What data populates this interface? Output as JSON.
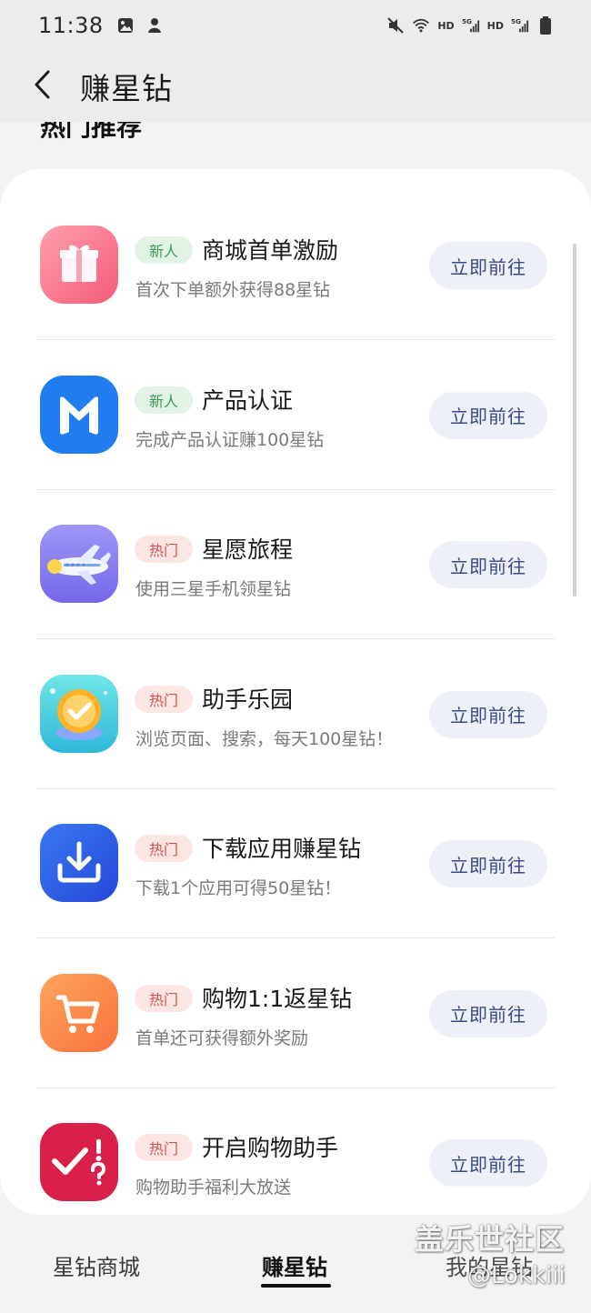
{
  "status_bar": {
    "time": "11:38",
    "icons_left": [
      "gallery-icon",
      "notification-icon"
    ],
    "icons_right": [
      "mute-icon",
      "wifi-icon",
      "hd-label",
      "signal-5g-icon",
      "hd-label",
      "signal-5g-icon",
      "battery-icon"
    ],
    "hd_label": "HD"
  },
  "header": {
    "title": "赚星钻",
    "back_icon": "back-arrow-icon"
  },
  "section": {
    "title": "热门推荐"
  },
  "tasks": [
    {
      "badge": "新人",
      "badge_type": "new",
      "title": "商城首单激励",
      "desc": "首次下单额外获得88星钻",
      "button": "立即前往",
      "icon": "gift-icon",
      "icon_color": "#f8758c"
    },
    {
      "badge": "新人",
      "badge_type": "new",
      "title": "产品认证",
      "desc": "完成产品认证赚100星钻",
      "button": "立即前往",
      "icon": "m-logo-icon",
      "icon_color": "#1f7df0"
    },
    {
      "badge": "热门",
      "badge_type": "hot",
      "title": "星愿旅程",
      "desc": "使用三星手机领星钻",
      "button": "立即前往",
      "icon": "airplane-icon",
      "icon_color": "#8f86f0"
    },
    {
      "badge": "热门",
      "badge_type": "hot",
      "title": "助手乐园",
      "desc": "浏览页面、搜索，每天100星钻！",
      "button": "立即前往",
      "icon": "checkmark-coin-icon",
      "icon_color": "#3fcfd8"
    },
    {
      "badge": "热门",
      "badge_type": "hot",
      "title": "下载应用赚星钻",
      "desc": "下载1个应用可得50星钻！",
      "button": "立即前往",
      "icon": "download-icon",
      "icon_color": "#2f5fe8"
    },
    {
      "badge": "热门",
      "badge_type": "hot",
      "title": "购物1:1返星钻",
      "desc": "首单还可获得额外奖励",
      "button": "立即前往",
      "icon": "shopping-cart-icon",
      "icon_color": "#fb8a4a"
    },
    {
      "badge": "热门",
      "badge_type": "hot",
      "title": "开启购物助手",
      "desc": "购物助手福利大放送",
      "button": "立即前往",
      "icon": "check-question-icon",
      "icon_color": "#d8204a"
    }
  ],
  "bottom_tabs": [
    {
      "label": "星钻商城",
      "active": false
    },
    {
      "label": "赚星钻",
      "active": true
    },
    {
      "label": "我的星钻",
      "active": false
    }
  ],
  "watermark": {
    "line1": "盖乐世社区",
    "line2": "@Lokkiii"
  },
  "colors": {
    "accent_button_bg": "#eef0f8",
    "accent_button_text": "#3a4a86",
    "badge_new_bg": "#e2f3e6",
    "badge_new_text": "#3c9a55",
    "badge_hot_bg": "#fbe6e4",
    "badge_hot_text": "#d1534a"
  }
}
